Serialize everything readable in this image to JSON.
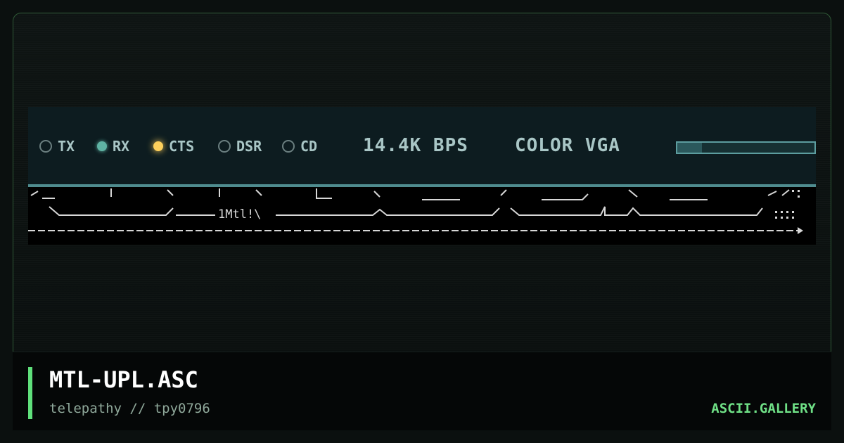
{
  "artwork": {
    "indicators": [
      {
        "label": "TX",
        "state": "off"
      },
      {
        "label": "RX",
        "state": "rx"
      },
      {
        "label": "CTS",
        "state": "cts"
      },
      {
        "label": "DSR",
        "state": "off"
      },
      {
        "label": "CD",
        "state": "off"
      }
    ],
    "speed": "14.4K BPS",
    "display_mode": "COLOR VGA",
    "progress_fraction": 0.18,
    "ascii_text": "1Mtl!\\",
    "colors": {
      "led_rx": "#5fb3a4",
      "led_cts": "#ffd15c",
      "status_text": "#a9c6c6"
    }
  },
  "footer": {
    "title": "MTL-UPL.ASC",
    "subtitle": "telepathy // tpy0796",
    "site": "ASCII.GALLERY",
    "accent_color": "#5fe07b"
  }
}
